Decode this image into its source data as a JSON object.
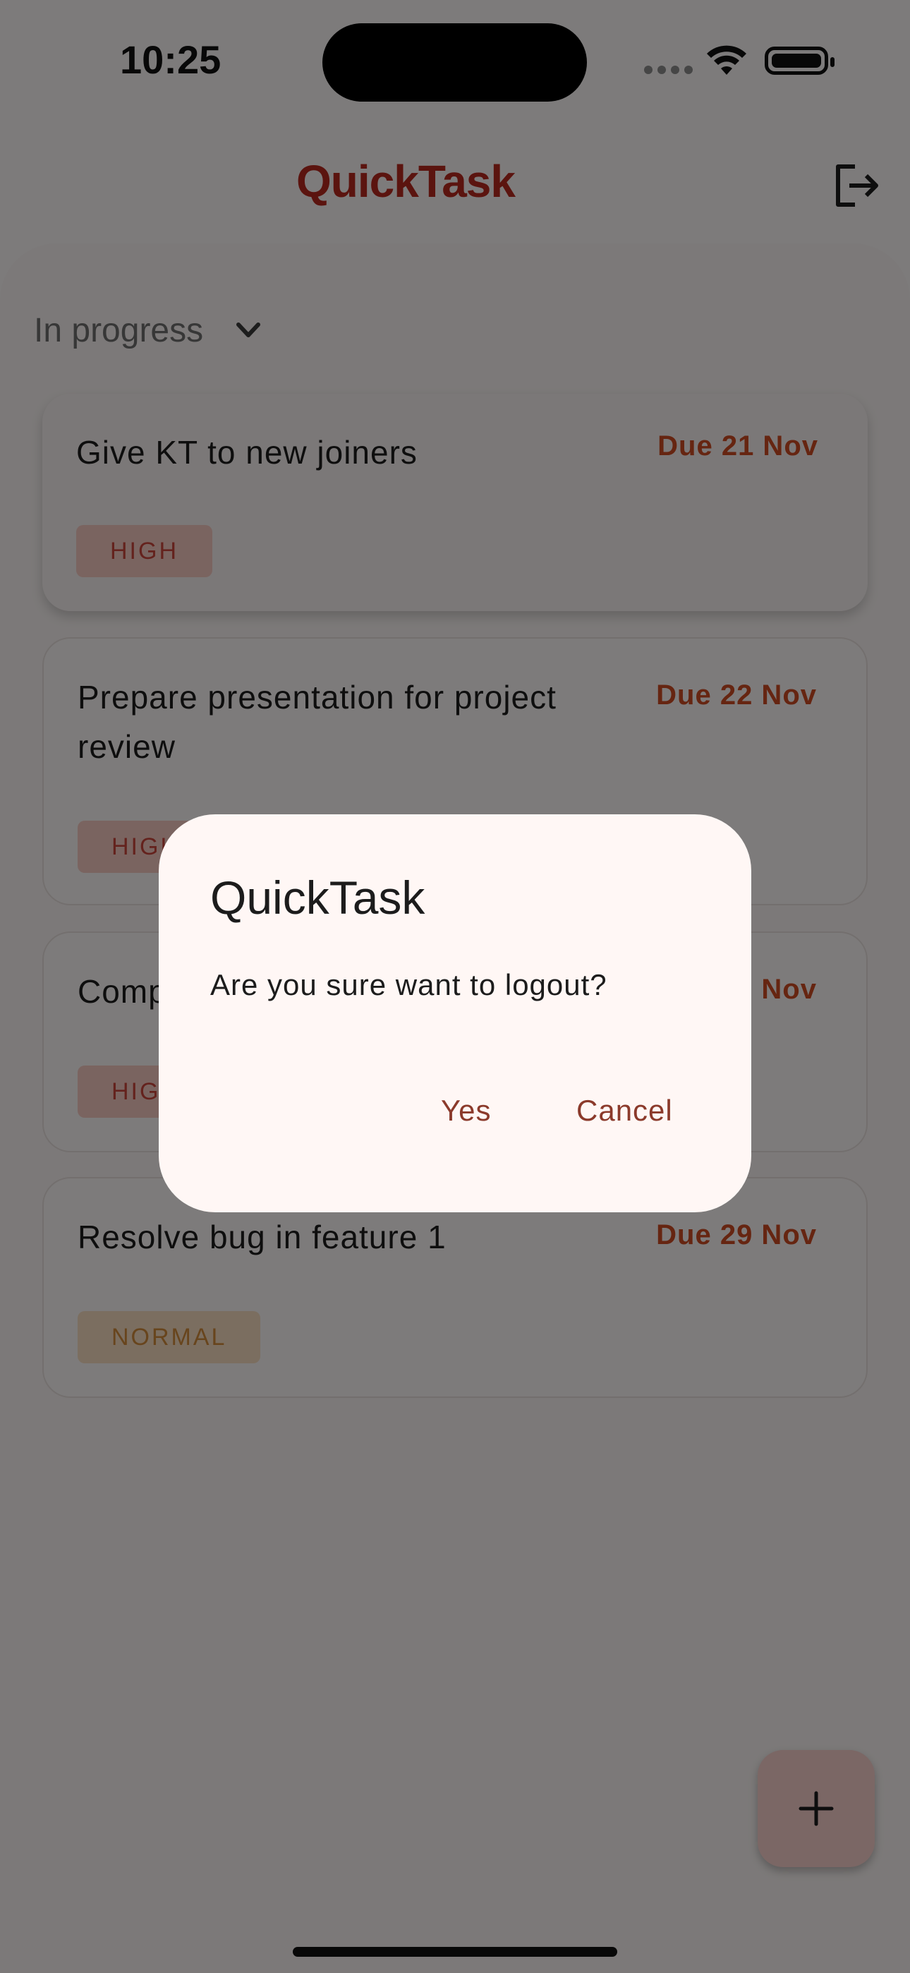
{
  "status_bar": {
    "time": "10:25"
  },
  "app_bar": {
    "title": "QuickTask",
    "logout_icon": "logout-icon"
  },
  "filter": {
    "selected": "In progress",
    "icon": "chevron-down-icon"
  },
  "tasks": [
    {
      "title": "Give KT to new joiners",
      "due": "Due 21 Nov",
      "priority": "HIGH"
    },
    {
      "title": "Prepare presentation for project review",
      "due": "Due 22 Nov",
      "priority": "HIGH"
    },
    {
      "title": "Comp",
      "due": "Nov",
      "priority": "HIG"
    },
    {
      "title": "Resolve bug in feature 1",
      "due": "Due 29 Nov",
      "priority": "NORMAL"
    }
  ],
  "fab": {
    "icon": "plus-icon"
  },
  "dialog": {
    "title": "QuickTask",
    "message": "Are you sure want to logout?",
    "confirm_label": "Yes",
    "cancel_label": "Cancel"
  },
  "colors": {
    "brand": "#b7281e",
    "due": "#cc4a22",
    "high_badge_bg": "#f5c9c1",
    "normal_badge_bg": "#f7dcc0",
    "dialog_button": "#8b3a2b"
  }
}
